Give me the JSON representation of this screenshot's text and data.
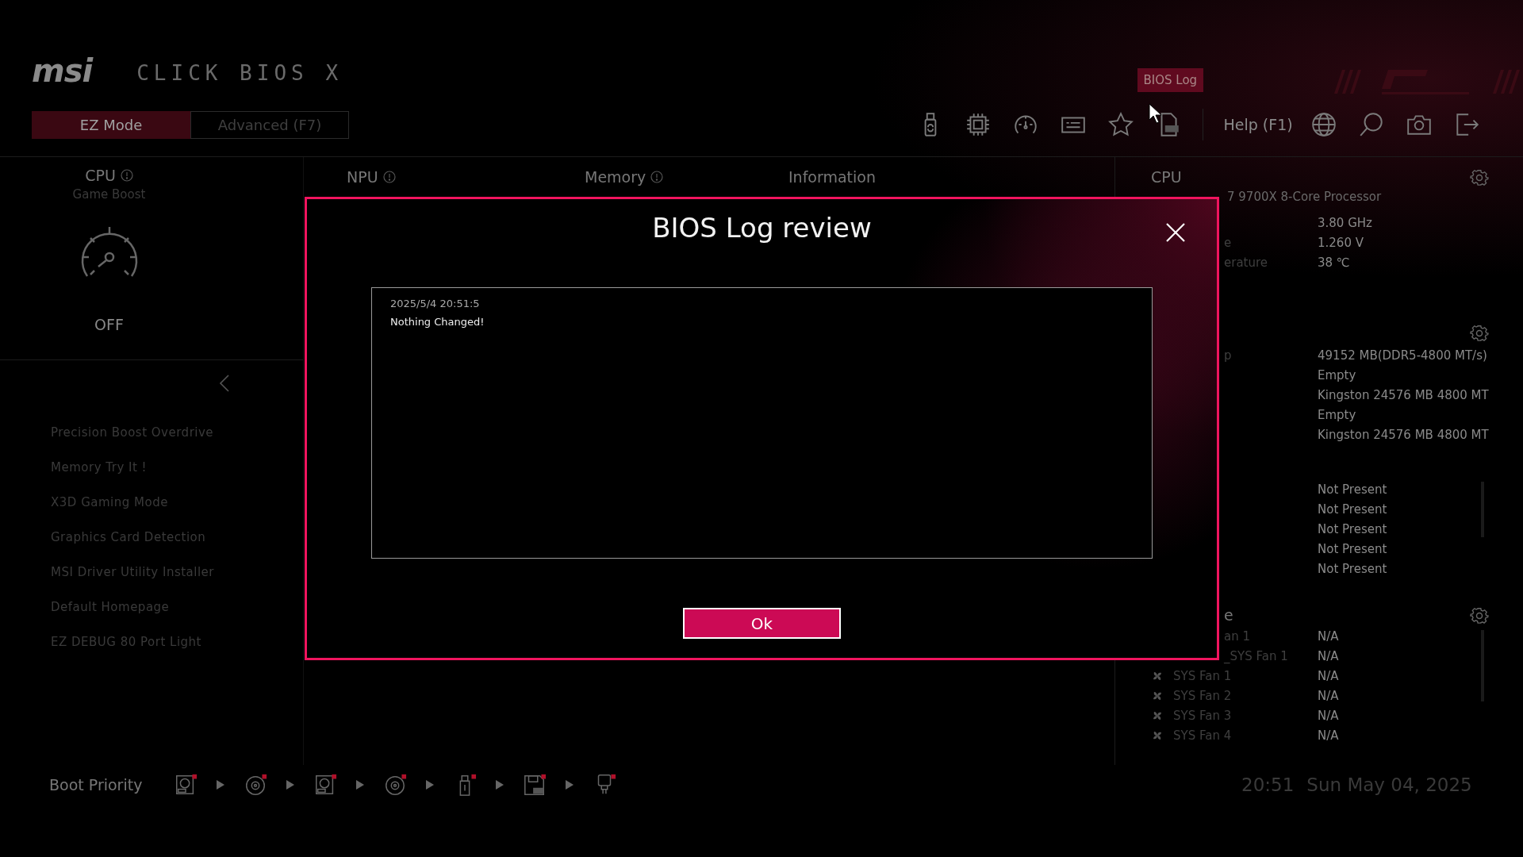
{
  "header": {
    "logo": "msi",
    "product": "CLICK BIOS X",
    "modes": [
      {
        "label": "EZ Mode",
        "selected": true
      },
      {
        "label": "Advanced (F7)",
        "selected": false
      }
    ],
    "toolbar": [
      {
        "kind": "usb"
      },
      {
        "kind": "chip"
      },
      {
        "kind": "gauge"
      },
      {
        "kind": "card"
      },
      {
        "kind": "star"
      },
      {
        "kind": "log",
        "tooltip": "BIOS Log"
      }
    ],
    "help": "Help (F1)",
    "tools": [
      {
        "kind": "globe"
      },
      {
        "kind": "search"
      },
      {
        "kind": "camera"
      },
      {
        "kind": "exit"
      }
    ]
  },
  "overview": {
    "cpu": {
      "title": "CPU",
      "subtitle": "Game Boost",
      "state": "OFF"
    },
    "columns": [
      {
        "title": "NPU",
        "info": true
      },
      {
        "title": "Memory",
        "info": true
      },
      {
        "title": "Information",
        "info": false
      }
    ]
  },
  "features": [
    "Precision Boost Overdrive",
    "Memory Try It !",
    "X3D Gaming Mode",
    "Graphics Card Detection",
    "MSI Driver Utility Installer",
    "Default Homepage",
    "EZ DEBUG 80 Port Light"
  ],
  "info_panel": {
    "sections": [
      {
        "kind": "cpu",
        "title": "CPU",
        "subtitle": "7 9700X 8-Core Processor",
        "gear": true,
        "rows": [
          {
            "value": "3.80 GHz"
          },
          {
            "label": "e",
            "clipped": true,
            "value": "1.260 V"
          },
          {
            "label": "erature",
            "clipped": true,
            "value": "38 ℃"
          }
        ]
      },
      {
        "kind": "memory",
        "gear": true,
        "rows": [
          {
            "label": "p",
            "clipped": true,
            "value": "49152 MB(DDR5-4800 MT/s)"
          },
          {
            "value": "Empty"
          },
          {
            "value": "Kingston 24576 MB 4800 MT"
          },
          {
            "value": "Empty"
          },
          {
            "value": "Kingston 24576 MB 4800 MT"
          }
        ]
      },
      {
        "kind": "storage",
        "gear": false,
        "rows": [
          {
            "value": "Not Present"
          },
          {
            "value": "Not Present"
          },
          {
            "value": "Not Present"
          },
          {
            "value": "Not Present"
          },
          {
            "value": "Not Present"
          }
        ]
      },
      {
        "kind": "fans",
        "title": "e",
        "gear": true,
        "rows": [
          {
            "label": "an 1",
            "clipped": true,
            "value": "N/A"
          },
          {
            "label": "_SYS Fan 1",
            "clipped": true,
            "value": "N/A"
          },
          {
            "label": "SYS Fan 1",
            "clipped": false,
            "value": "N/A"
          },
          {
            "label": "SYS Fan 2",
            "clipped": false,
            "value": "N/A"
          },
          {
            "label": "SYS Fan 3",
            "clipped": false,
            "value": "N/A"
          },
          {
            "label": "SYS Fan 4",
            "clipped": false,
            "value": "N/A"
          }
        ]
      }
    ]
  },
  "boot": {
    "label": "Boot Priority",
    "devices": [
      {
        "kind": "hdd"
      },
      {
        "kind": "disc"
      },
      {
        "kind": "hdd"
      },
      {
        "kind": "disc"
      },
      {
        "kind": "usb"
      },
      {
        "kind": "floppy"
      },
      {
        "kind": "usb-key"
      }
    ]
  },
  "clock": {
    "time": "20:51",
    "date": "Sun May 04, 2025"
  },
  "dialog": {
    "title": "BIOS Log review",
    "timestamp": "2025/5/4 20:51:5",
    "message": "Nothing Changed!",
    "button": "Ok"
  }
}
